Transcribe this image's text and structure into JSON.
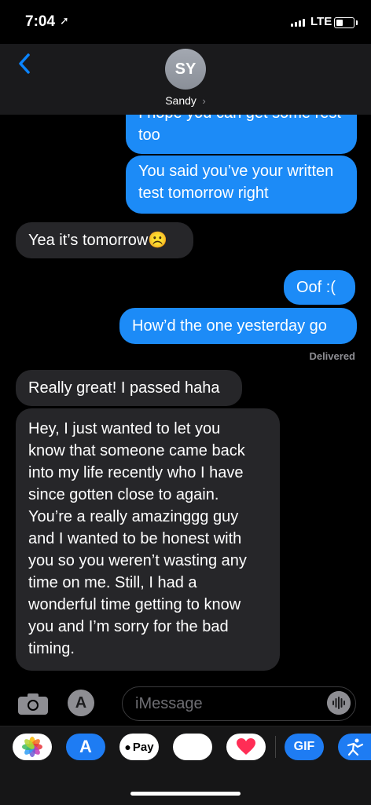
{
  "status_bar": {
    "time": "7:04",
    "network": "LTE"
  },
  "header": {
    "avatar_initials": "SY",
    "contact_name": "Sandy"
  },
  "messages": [
    {
      "side": "out",
      "lines": [
        "I hope you can get some rest",
        "too"
      ]
    },
    {
      "side": "out",
      "lines": [
        "You said you’ve your written",
        "test tomorrow right"
      ]
    },
    {
      "side": "in",
      "lines": [
        "Yea it’s tomorrow☹️"
      ]
    },
    {
      "side": "out",
      "lines": [
        "Oof :("
      ]
    },
    {
      "side": "out",
      "lines": [
        "How’d the one yesterday go"
      ]
    },
    {
      "side": "in",
      "lines": [
        "Really great! I passed haha"
      ]
    },
    {
      "side": "in",
      "lines": [
        "Hey, I just wanted to let you",
        "know that someone came back",
        "into my life recently who I have",
        "since gotten close to again.",
        "You’re a really amazinggg guy",
        "and I wanted to be honest with",
        "you so you weren’t wasting any",
        "time on me. Still, I had a",
        "wonderful time getting to know",
        "you and I’m sorry for the bad",
        "timing."
      ]
    }
  ],
  "delivered_label": "Delivered",
  "input": {
    "placeholder": "iMessage"
  },
  "drawer": {
    "apple_pay_label": "Pay",
    "gif_label": "GIF"
  },
  "colors": {
    "outgoing": "#1c8bf7",
    "incoming": "#262629",
    "accent": "#0a84ff"
  }
}
